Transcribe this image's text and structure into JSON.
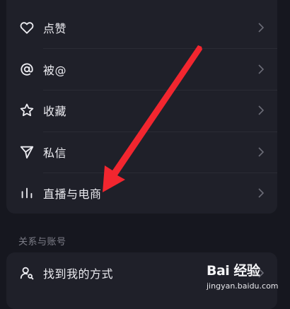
{
  "settings": {
    "items": [
      {
        "label": "点赞",
        "icon": "heart-icon"
      },
      {
        "label": "被@",
        "icon": "at-icon"
      },
      {
        "label": "收藏",
        "icon": "star-icon"
      },
      {
        "label": "私信",
        "icon": "send-icon"
      },
      {
        "label": "直播与电商",
        "icon": "live-bars-icon"
      }
    ],
    "section_title": "关系与账号",
    "section_items": [
      {
        "label": "找到我的方式",
        "icon": "person-search-icon"
      }
    ]
  },
  "watermark": {
    "logo": "Bai 经验",
    "url": "jingyan.baidu.com"
  },
  "colors": {
    "background": "#16171f",
    "card": "#1f2029",
    "text": "#ececf1",
    "muted": "#7d7e88",
    "annotation_arrow": "#f2262f"
  }
}
